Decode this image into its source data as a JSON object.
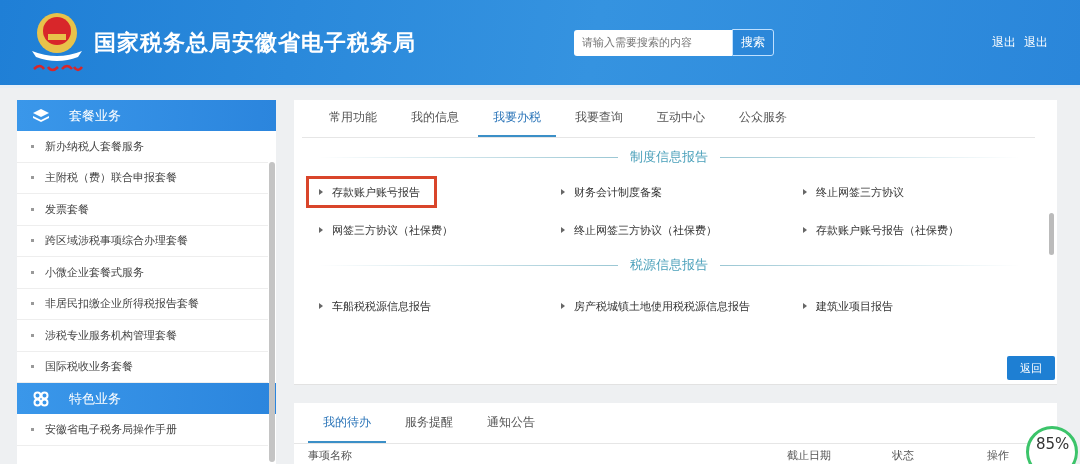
{
  "header": {
    "title": "国家税务总局安徽省电子税务局",
    "search": {
      "placeholder": "请输入需要搜索的内容",
      "button": "搜索"
    },
    "links": [
      "退出",
      "退出"
    ]
  },
  "sidebar": {
    "groups": [
      {
        "title": "套餐业务",
        "items": [
          "新办纳税人套餐服务",
          "主附税（费）联合申报套餐",
          "发票套餐",
          "跨区域涉税事项综合办理套餐",
          "小微企业套餐式服务",
          "非居民扣缴企业所得税报告套餐",
          "涉税专业服务机构管理套餐",
          "国际税收业务套餐"
        ]
      },
      {
        "title": "特色业务",
        "items": [
          "安徽省电子税务局操作手册"
        ]
      }
    ]
  },
  "main": {
    "tabs": [
      {
        "label": "常用功能",
        "selected": false
      },
      {
        "label": "我的信息",
        "selected": false
      },
      {
        "label": "我要办税",
        "selected": true
      },
      {
        "label": "我要查询",
        "selected": false
      },
      {
        "label": "互动中心",
        "selected": false
      },
      {
        "label": "公众服务",
        "selected": false
      }
    ],
    "sections": [
      {
        "title": "制度信息报告",
        "items": [
          {
            "label": "存款账户账号报告",
            "highlighted": true
          },
          {
            "label": "财务会计制度备案",
            "highlighted": false
          },
          {
            "label": "终止网签三方协议",
            "highlighted": false
          },
          {
            "label": "网签三方协议（社保费）",
            "highlighted": false
          },
          {
            "label": "终止网签三方协议（社保费）",
            "highlighted": false
          },
          {
            "label": "存款账户账号报告（社保费）",
            "highlighted": false
          }
        ]
      },
      {
        "title": "税源信息报告",
        "items": [
          {
            "label": "车船税税源信息报告",
            "highlighted": false
          },
          {
            "label": "房产税城镇土地使用税税源信息报告",
            "highlighted": false
          },
          {
            "label": "建筑业项目报告",
            "highlighted": false
          }
        ]
      }
    ],
    "back_button": "返回"
  },
  "todo": {
    "tabs": [
      {
        "label": "我的待办",
        "selected": true
      },
      {
        "label": "服务提醒",
        "selected": false
      },
      {
        "label": "通知公告",
        "selected": false
      }
    ],
    "columns": [
      "事项名称",
      "截止日期",
      "状态",
      "操作"
    ]
  },
  "progress_badge": {
    "text": "85%"
  }
}
